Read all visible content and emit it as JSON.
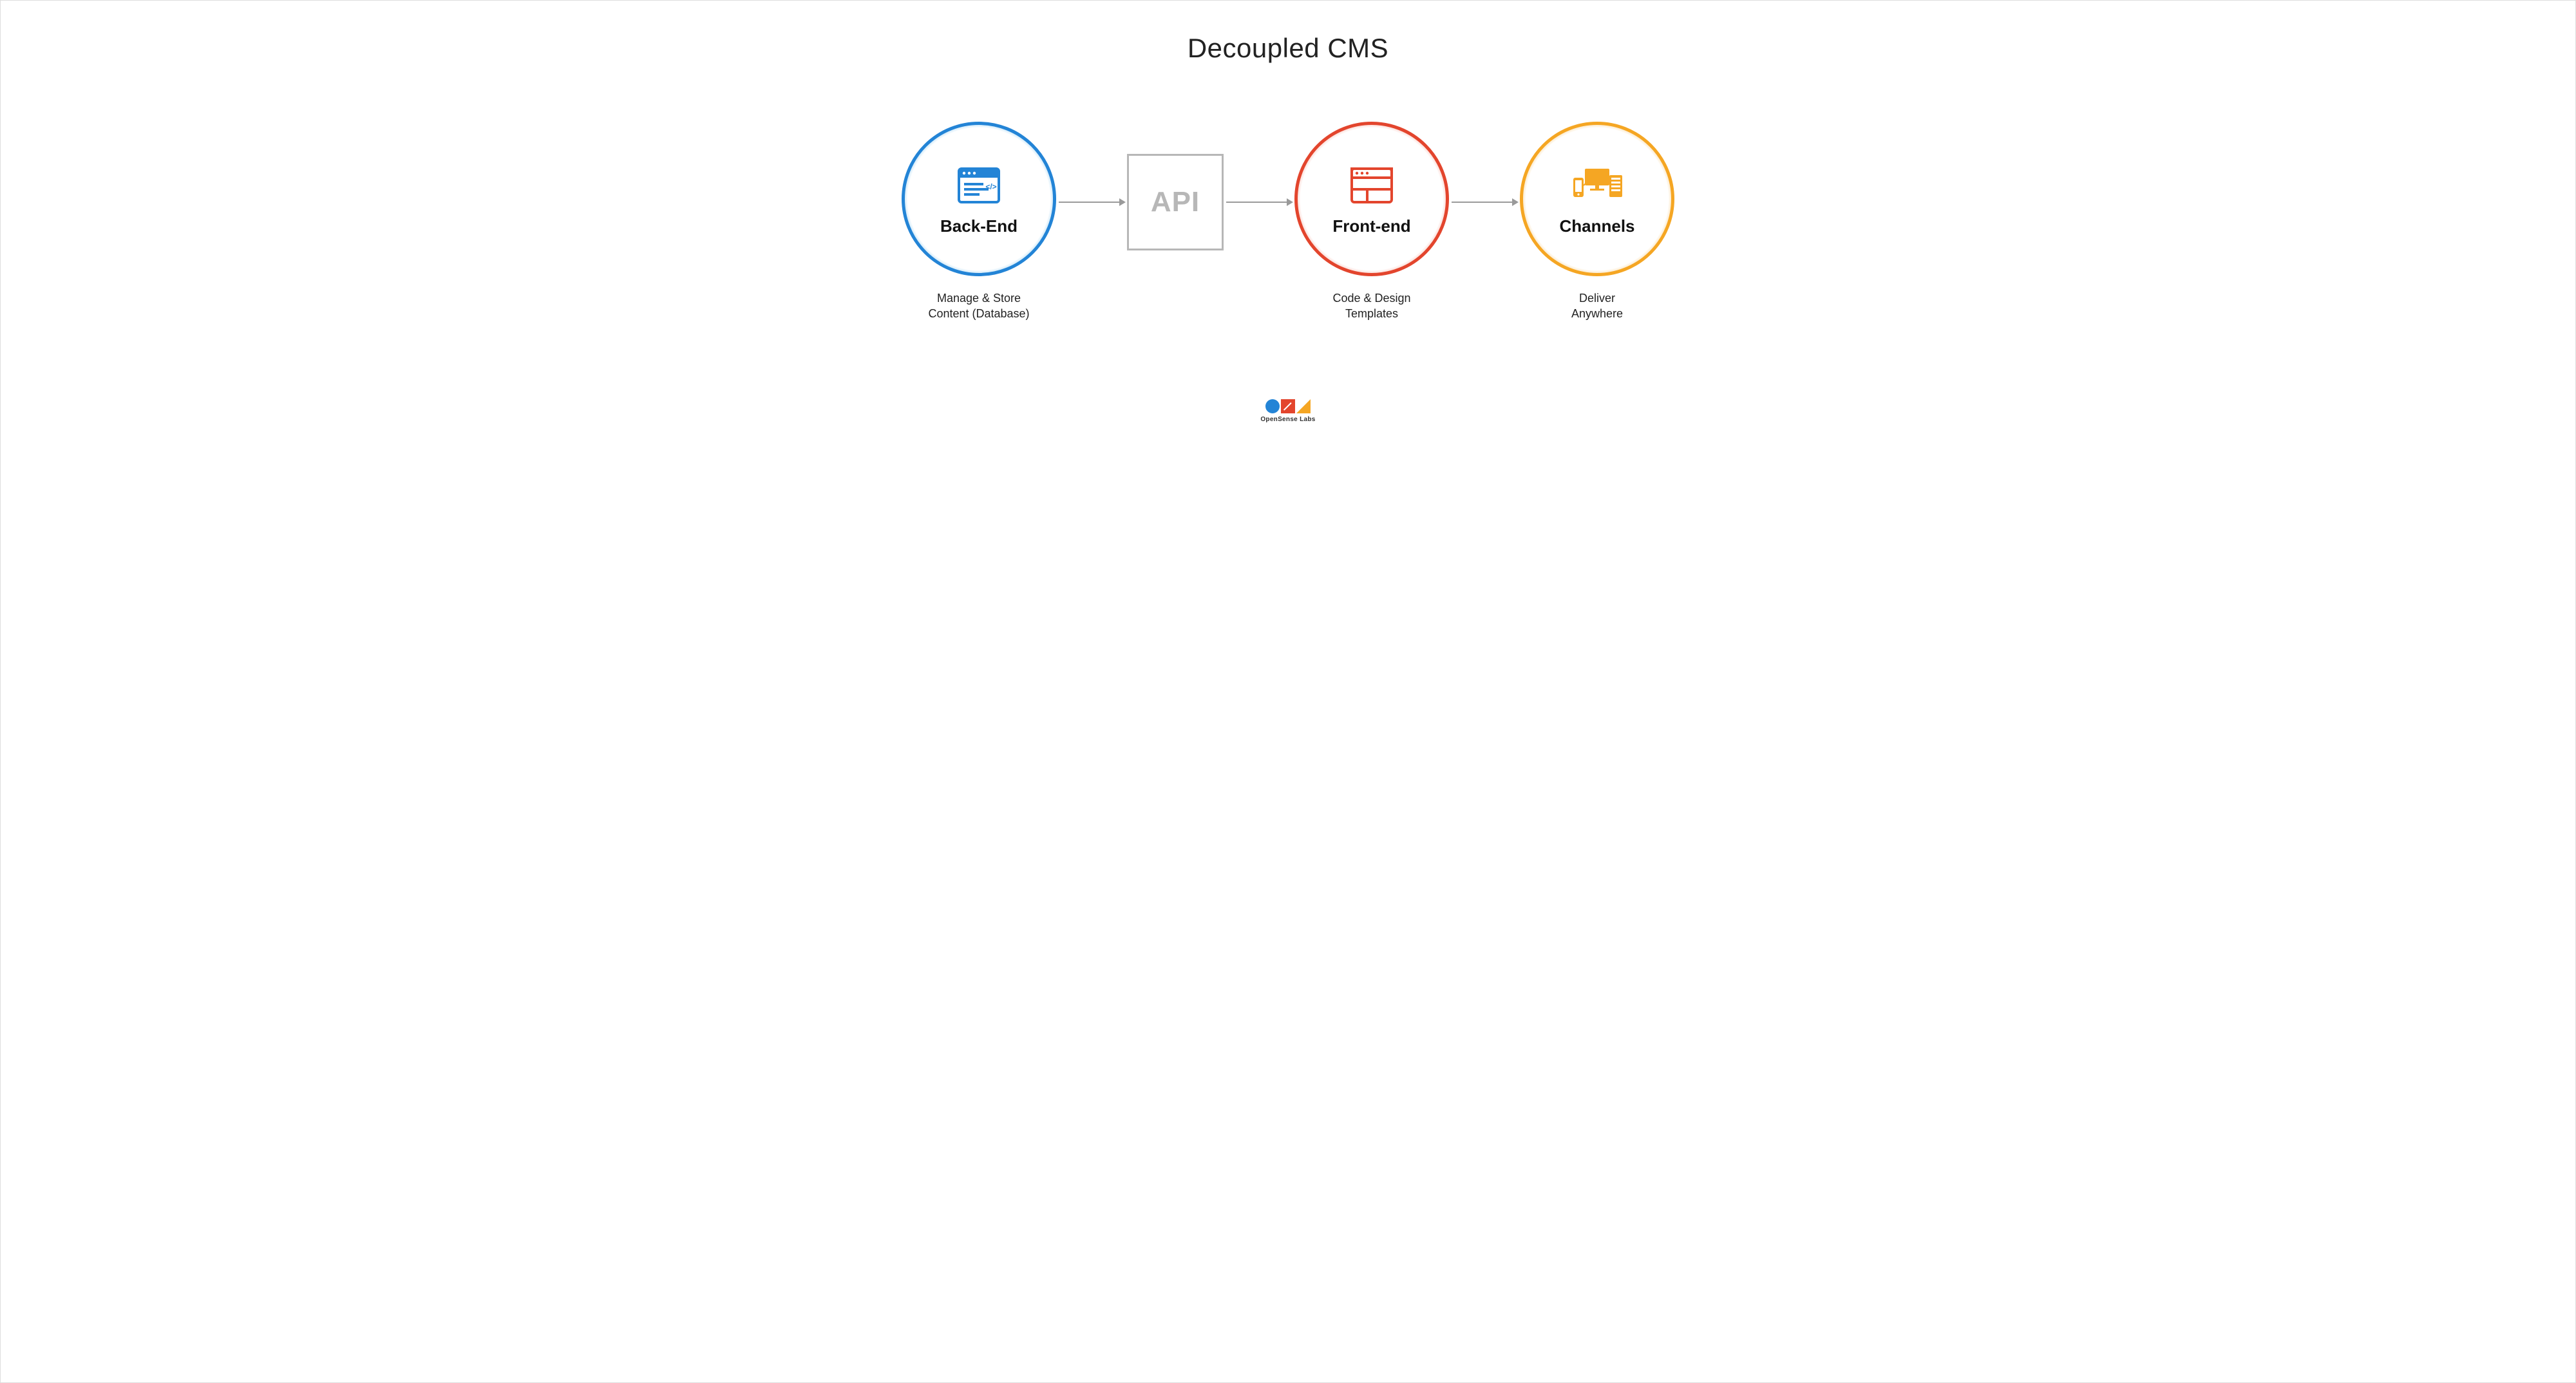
{
  "title": "Decoupled CMS",
  "nodes": {
    "backend": {
      "label": "Back-End",
      "subtitle_l1": "Manage & Store",
      "subtitle_l2": "Content (Database)"
    },
    "api": {
      "label": "API"
    },
    "frontend": {
      "label": "Front-end",
      "subtitle_l1": "Code & Design",
      "subtitle_l2": "Templates"
    },
    "channels": {
      "label": "Channels",
      "subtitle_l1": "Deliver",
      "subtitle_l2": "Anywhere"
    }
  },
  "colors": {
    "blue": "#2384d6",
    "red": "#e3452d",
    "orange": "#f5a623",
    "gray": "#b7b7b7"
  },
  "attribution": "OpenSense Labs"
}
